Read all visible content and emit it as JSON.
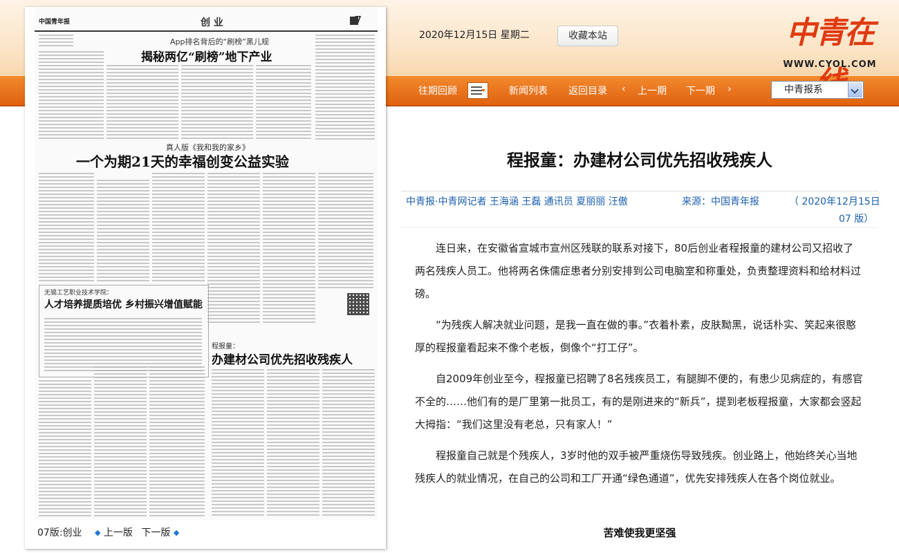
{
  "header": {
    "date": "2020年12月15日  星期二",
    "bookmark_label": "收藏本站",
    "logo_text": "中青在线",
    "logo_url": "WWW.CYOL.COM"
  },
  "nav": {
    "archive": "往期回顾",
    "news_list": "新闻列表",
    "back_to_index": "返回目录",
    "prev_page": "上一期",
    "next_page": "下一期",
    "paper_select": "中青报系"
  },
  "paper": {
    "masthead": "中国青年报",
    "section": "创 业",
    "page_number": "7",
    "story1_kicker": "App排名背后的“刷榜”黑儿规",
    "story1_headline": "揭秘两亿“刷榜”地下产业",
    "story2_kicker": "真人版《我和我的家乡》",
    "story2_headline": "一个为期21天的幸福创变公益实验",
    "story3_kicker": "无锡工艺职业技术学院：",
    "story3_headline": "人才培养提质培优  乡村振兴增值赋能",
    "story4_kicker": "程报童：",
    "story4_headline": "办建材公司优先招收残疾人",
    "footer_page": "07版:创业",
    "footer_prev": "上一版",
    "footer_next": "下一版"
  },
  "article": {
    "title": "程报童：办建材公司优先招收残疾人",
    "byline": "中青报·中青网记者  王海涵  王磊  通讯员  夏丽丽  汪傲",
    "source": "来源：中国青年报",
    "pub_date": "（  2020年12月15日",
    "pub_edition": "07  版）",
    "paragraphs": [
      "连日来，在安徽省宣城市宣州区残联的联系对接下，80后创业者程报童的建材公司又招收了两名残疾人员工。他将两名侏儒症患者分别安排到公司电脑室和称重处，负责整理资料和给材料过磅。",
      "“为残疾人解决就业问题，是我一直在做的事。”衣着朴素，皮肤黝黑，说话朴实、笑起来很憨厚的程报童看起来不像个老板，倒像个“打工仔”。",
      "自2009年创业至今，程报童已招聘了8名残疾员工，有腿脚不便的，有患少见病症的，有感官不全的……他们有的是厂里第一批员工，有的是刚进来的“新兵”，提到老板程报童，大家都会竖起大拇指：“我们这里没有老总，只有家人！”",
      "程报童自己就是个残疾人，3岁时他的双手被严重烧伤导致残疾。创业路上，他始终关心当地残疾人的就业情况，在自己的公司和工厂开通“绿色通道”，优先安排残疾人在各个岗位就业。"
    ],
    "subheading": "苦难使我更坚强"
  },
  "colors": {
    "nav_orange": "#e86f1a",
    "link_blue": "#1b5fae",
    "logo_red": "#e03a10"
  }
}
